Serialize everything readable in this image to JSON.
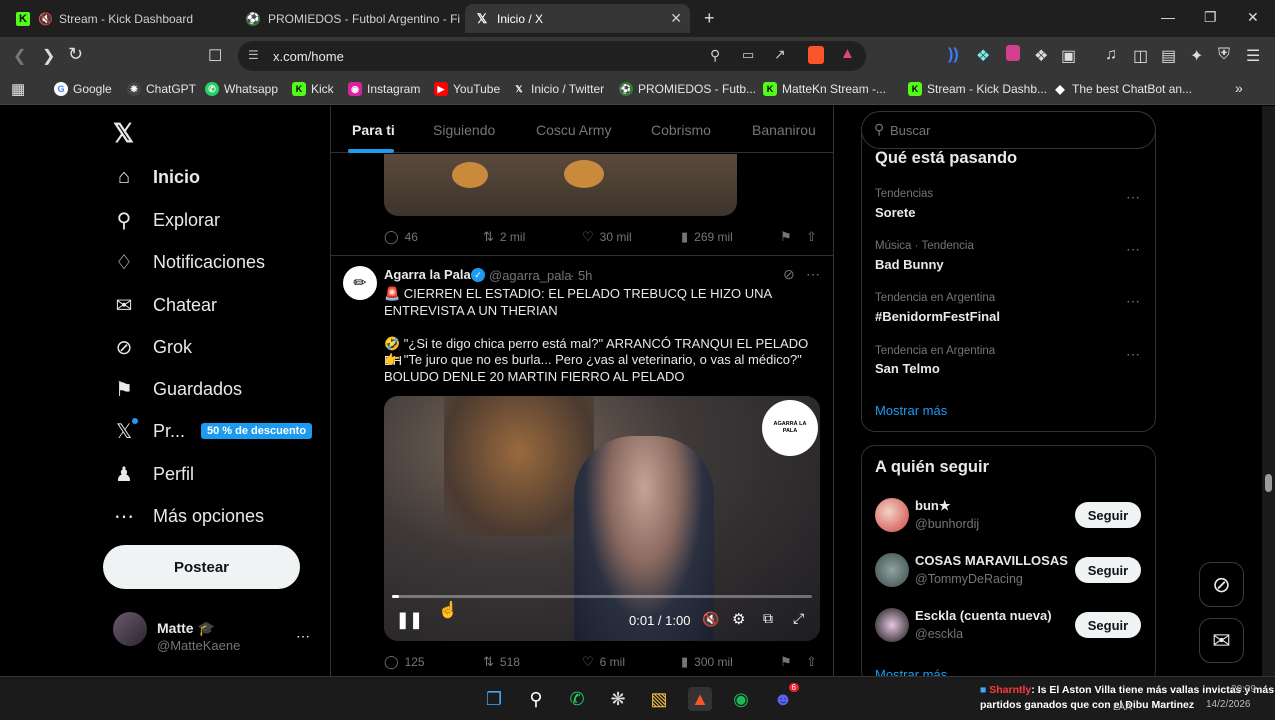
{
  "browser": {
    "tabs": [
      {
        "title": "Stream - Kick Dashboard"
      },
      {
        "title": "PROMIEDOS - Futbol Argentino - Fixt"
      },
      {
        "title": "Inicio / X"
      }
    ],
    "url": "x.com/home",
    "bookmarks": [
      "Google",
      "ChatGPT",
      "Whatsapp",
      "Kick",
      "Instagram",
      "YouTube",
      "Inicio / Twitter",
      "PROMIEDOS - Futb...",
      "MatteKn Stream -...",
      "Stream - Kick Dashb...",
      "The best ChatBot an..."
    ]
  },
  "sidebar": {
    "items": [
      {
        "label": "Inicio",
        "icon": "home-icon"
      },
      {
        "label": "Explorar",
        "icon": "search-icon"
      },
      {
        "label": "Notificaciones",
        "icon": "bell-icon"
      },
      {
        "label": "Chatear",
        "icon": "mail-icon"
      },
      {
        "label": "Grok",
        "icon": "grok-icon"
      },
      {
        "label": "Guardados",
        "icon": "bookmark-icon"
      },
      {
        "label": "Pr...",
        "icon": "x-icon",
        "badge": "50 % de descuento"
      },
      {
        "label": "Perfil",
        "icon": "person-icon"
      },
      {
        "label": "Más opciones",
        "icon": "more-circle-icon"
      }
    ],
    "post_button": "Postear",
    "account": {
      "name": "Matte 🎓",
      "handle": "@MatteKaene"
    }
  },
  "feed": {
    "tabs": [
      "Para ti",
      "Siguiendo",
      "Coscu Army",
      "Cobrismo",
      "Bananirou"
    ],
    "prev_tweet_stats": {
      "replies": "46",
      "reposts": "2 mil",
      "likes": "30 mil",
      "views": "269 mil"
    },
    "tweet": {
      "name": "Agarra la Pala",
      "handle": "@agarra_pala",
      "time": "· 5h",
      "line1": "🚨 CIERREN EL ESTADIO: EL PELADO TREBUCQ LE HIZO UNA ENTREVISTA A UN THERIAN",
      "line2": "🤣 \"¿Si te digo chica perro está mal?\" ARRANCÓ TRANQUI EL PELADO EH",
      "line3": "👉 \"Te juro que no es burla... Pero ¿vas al veterinario, o vas al médico?\"",
      "line4": "BOLUDO DENLE 20 MARTIN FIERRO AL PELADO",
      "video_time": "0:01 / 1:00",
      "video_progress": 0.017,
      "logo_text": "AGARRÁ LA PALA",
      "stats": {
        "replies": "125",
        "reposts": "518",
        "likes": "6 mil",
        "views": "300 mil"
      }
    }
  },
  "right": {
    "search_placeholder": "Buscar",
    "trends_title": "Qué está pasando",
    "trends": [
      {
        "context": "Tendencias",
        "name": "Sorete"
      },
      {
        "context": "Música · Tendencia",
        "name": "Bad Bunny"
      },
      {
        "context": "Tendencia en Argentina",
        "name": "#BenidormFestFinal"
      },
      {
        "context": "Tendencia en Argentina",
        "name": "San Telmo"
      }
    ],
    "show_more": "Mostrar más",
    "follow_title": "A quién seguir",
    "follow": [
      {
        "name": "bun★",
        "handle": "@bunhordij",
        "button": "Seguir"
      },
      {
        "name": "COSAS MARAVILLOSAS",
        "handle": "@TommyDeRacing",
        "button": "Seguir"
      },
      {
        "name": "Esckla (cuenta nueva)",
        "handle": "@esckla",
        "button": "Seguir"
      }
    ],
    "follow_show_more": "Mostrar más"
  },
  "taskbar": {
    "ticker_user": "Sharntly",
    "ticker_text": ": Is El Aston Villa tiene más vallas invictas y más partidos ganados que con el Dibu Martinez",
    "time": "20:39",
    "date": "14/2/2026",
    "lang": "LAA",
    "discord_badge": "6"
  },
  "colors": {
    "accent": "#1d9bf0",
    "bg": "#000000",
    "muted": "#71767b",
    "border": "#2f3336"
  }
}
